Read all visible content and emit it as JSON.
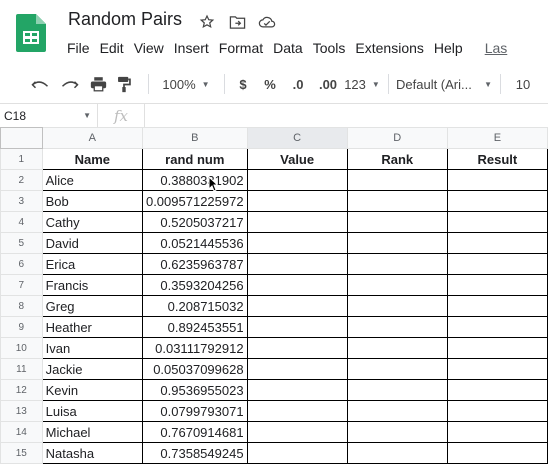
{
  "app": {
    "title": "Random Pairs",
    "menus": [
      "File",
      "Edit",
      "View",
      "Insert",
      "Format",
      "Data",
      "Tools",
      "Extensions",
      "Help"
    ],
    "last_edit": "Las"
  },
  "toolbar": {
    "zoom": "100%",
    "currency": "$",
    "percent": "%",
    "dec_decrease": ".0",
    "dec_increase": ".00",
    "format_more": "123",
    "font": "Default (Ari...",
    "font_size": "10"
  },
  "formula_bar": {
    "name_box": "C18",
    "fx": "fx",
    "value": ""
  },
  "sheet": {
    "columns": [
      "A",
      "B",
      "C",
      "D",
      "E"
    ],
    "header_row": [
      "Name",
      "rand num",
      "Value",
      "Rank",
      "Result"
    ],
    "rows": [
      {
        "num": "2",
        "name": "Alice",
        "rand": "0.3880331902"
      },
      {
        "num": "3",
        "name": "Bob",
        "rand": "0.009571225972"
      },
      {
        "num": "4",
        "name": "Cathy",
        "rand": "0.5205037217"
      },
      {
        "num": "5",
        "name": "David",
        "rand": "0.0521445536"
      },
      {
        "num": "6",
        "name": "Erica",
        "rand": "0.6235963787"
      },
      {
        "num": "7",
        "name": "Francis",
        "rand": "0.3593204256"
      },
      {
        "num": "8",
        "name": "Greg",
        "rand": "0.208715032"
      },
      {
        "num": "9",
        "name": "Heather",
        "rand": "0.892453551"
      },
      {
        "num": "10",
        "name": "Ivan",
        "rand": "0.03111792912"
      },
      {
        "num": "11",
        "name": "Jackie",
        "rand": "0.05037099628"
      },
      {
        "num": "12",
        "name": "Kevin",
        "rand": "0.9536955023"
      },
      {
        "num": "13",
        "name": "Luisa",
        "rand": "0.0799793071"
      },
      {
        "num": "14",
        "name": "Michael",
        "rand": "0.7670914681"
      },
      {
        "num": "15",
        "name": "Natasha",
        "rand": "0.7358549245"
      }
    ]
  },
  "colors": {
    "sheets_green": "#23a566",
    "header_bg": "#f8f9fa",
    "selected_col_bg": "#e8eaed"
  },
  "icons": [
    "star-icon",
    "move-folder-icon",
    "cloud-status-icon",
    "undo-icon",
    "redo-icon",
    "print-icon",
    "paint-format-icon"
  ]
}
